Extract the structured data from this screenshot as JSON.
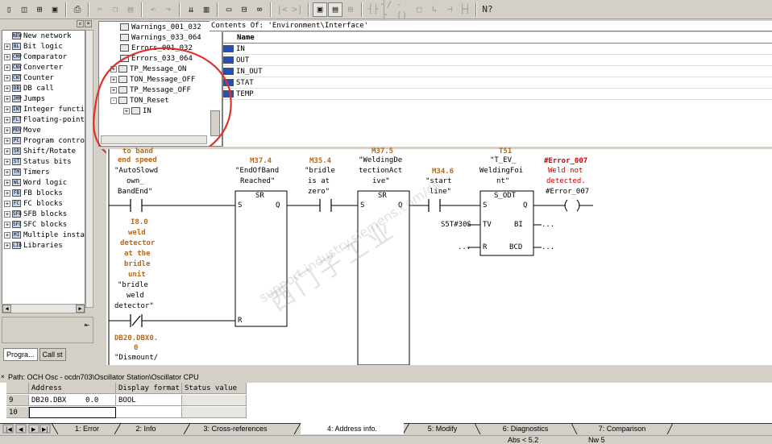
{
  "toolbar": {
    "buttons": [
      "new-icon",
      "open-icon",
      "accessible-nodes-icon",
      "save-icon",
      "print-icon",
      "cut-icon",
      "copy-icon",
      "paste-icon",
      "undo-icon",
      "redo-icon",
      "download-icon",
      "monitor-icon",
      "overview-icon",
      "network-icon",
      "variable-icon",
      "nc-contact-icon",
      "no-contact-icon",
      "open-branch-icon",
      "close-branch-icon",
      "box-icon",
      "branch-icon",
      "jump-icon",
      "coil-icon",
      "help-icon"
    ]
  },
  "catalog": {
    "items": [
      {
        "label": "New network",
        "icon": "NEW"
      },
      {
        "label": "Bit logic",
        "icon": "BL"
      },
      {
        "label": "Comparator",
        "icon": "CMP"
      },
      {
        "label": "Converter",
        "icon": "CNV"
      },
      {
        "label": "Counter",
        "icon": "CNT"
      },
      {
        "label": "DB call",
        "icon": "DB"
      },
      {
        "label": "Jumps",
        "icon": "JMP"
      },
      {
        "label": "Integer function",
        "icon": "INT"
      },
      {
        "label": "Floating-point",
        "icon": "FLT"
      },
      {
        "label": "Move",
        "icon": "MOV"
      },
      {
        "label": "Program control",
        "icon": "PC"
      },
      {
        "label": "Shift/Rotate",
        "icon": "SR"
      },
      {
        "label": "Status bits",
        "icon": "ST"
      },
      {
        "label": "Timers",
        "icon": "TM"
      },
      {
        "label": "Word logic",
        "icon": "WL"
      },
      {
        "label": "FB blocks",
        "icon": "FB"
      },
      {
        "label": "FC blocks",
        "icon": "FC"
      },
      {
        "label": "SFB blocks",
        "icon": "SFB"
      },
      {
        "label": "SFC blocks",
        "icon": "SFC"
      },
      {
        "label": "Multiple instances",
        "icon": "MI"
      },
      {
        "label": "Libraries",
        "icon": "LIB"
      }
    ],
    "tabs": [
      "Progra...",
      "Call st"
    ]
  },
  "interface_tree": {
    "items": [
      {
        "label": "Warnings_001_032",
        "expander": ""
      },
      {
        "label": "Warnings_033_064",
        "expander": ""
      },
      {
        "label": "Errors_001_032",
        "expander": ""
      },
      {
        "label": "Errors_033_064",
        "expander": ""
      },
      {
        "label": "TP_Message_ON",
        "expander": "+"
      },
      {
        "label": "TON_Message_OFF",
        "expander": "+"
      },
      {
        "label": "TP_Message_OFF",
        "expander": "+"
      },
      {
        "label": "TON_Reset",
        "expander": "-"
      },
      {
        "label": "IN",
        "expander": "+"
      }
    ]
  },
  "contents": {
    "header": "Contents Of: 'Environment\\Interface'",
    "column": "Name",
    "rows": [
      "IN",
      "OUT",
      "IN_OUT",
      "STAT",
      "TEMP"
    ]
  },
  "ladder": {
    "top_comment": [
      "to band",
      "end speed"
    ],
    "contact1": [
      "\"AutoSlowd",
      "own_",
      "BandEnd\""
    ],
    "m37_4": {
      "addr": "M37.4",
      "name": [
        "\"EndOfBand",
        "Reached\""
      ]
    },
    "sr_label": "SR",
    "s_label": "S",
    "q_label": "Q",
    "r_label": "R",
    "m35_4": {
      "addr": "M35.4",
      "name": [
        "\"bridle",
        "is at",
        "zero\""
      ]
    },
    "m37_5": {
      "addr": "M37.5",
      "name": [
        "\"WeldingDe",
        "tectionAct",
        "ive\""
      ]
    },
    "m34_6": {
      "addr": "M34.6",
      "name": [
        "\"start",
        "line\""
      ]
    },
    "t51": {
      "addr": "T51",
      "name": [
        "\"T_EV_",
        "WeldingFoi",
        "nt\""
      ]
    },
    "timer_label": "S_ODT",
    "tv_label": "TV",
    "bi_label": "BI",
    "bcd_label": "BCD",
    "tv_value": "S5T#30S",
    "r_value": "...",
    "bi_out": "...",
    "bcd_out": "...",
    "coil": {
      "addr": "#Error_007",
      "comment": [
        "Weld not",
        "detected."
      ],
      "name": "#Error_007"
    },
    "i8_0": {
      "addr": "I8.0",
      "comment": [
        "weld",
        "detector",
        "at the",
        "bridle",
        "unit"
      ],
      "name": [
        "\"bridle",
        "weld",
        "detector\""
      ]
    },
    "db20": {
      "addr": [
        "DB20.DBX0.",
        "0"
      ],
      "name": "\"Dismount/"
    }
  },
  "watermark": [
    "西门子工业",
    "support.industry.siemens.com/cs"
  ],
  "path_bar": "Path: OCH Osc - ocdn703\\Oscillator Station\\Oscillator CPU",
  "var_table": {
    "headers": [
      "Address",
      "Display format",
      "Status value"
    ],
    "rows": [
      {
        "num": "9",
        "address": "DB20.DBX",
        "bit": "0.0",
        "format": "BOOL",
        "status": ""
      },
      {
        "num": "10",
        "address": "",
        "bit": "",
        "format": "",
        "status": ""
      }
    ]
  },
  "bottom_tabs": [
    "1: Error",
    "2: Info",
    "3: Cross-references",
    "4: Address info.",
    "5: Modify",
    "6: Diagnostics",
    "7: Comparison"
  ],
  "status_bar": [
    "Abs < 5.2",
    "Nw 5"
  ]
}
